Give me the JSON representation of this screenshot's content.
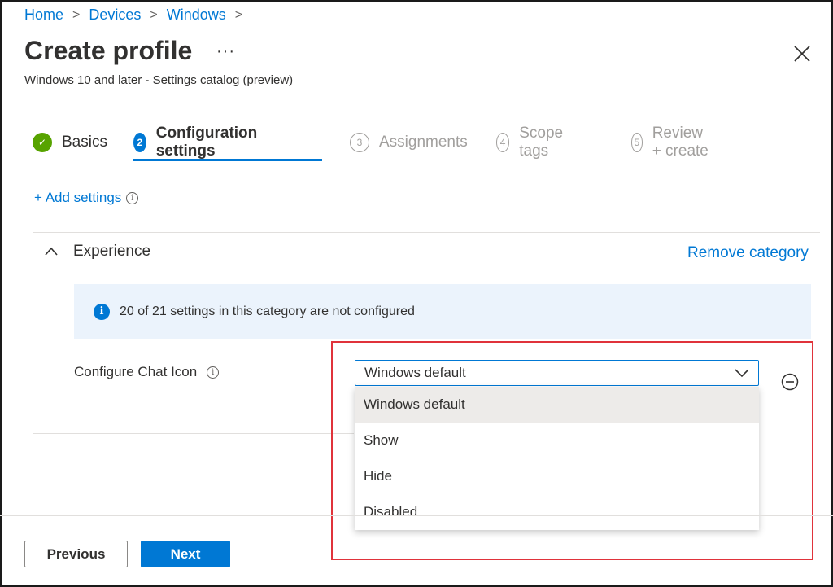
{
  "breadcrumb": [
    "Home",
    "Devices",
    "Windows"
  ],
  "header": {
    "title": "Create profile",
    "more": "···",
    "subtitle": "Windows 10 and later - Settings catalog (preview)"
  },
  "steps": [
    {
      "number": "✓",
      "label": "Basics",
      "state": "done"
    },
    {
      "number": "2",
      "label": "Configuration settings",
      "state": "active"
    },
    {
      "number": "3",
      "label": "Assignments",
      "state": "pending"
    },
    {
      "number": "4",
      "label": "Scope tags",
      "state": "pending"
    },
    {
      "number": "5",
      "label": "Review + create",
      "state": "pending"
    }
  ],
  "add_settings": {
    "label": "+ Add settings",
    "info": "i"
  },
  "category": {
    "name": "Experience",
    "remove_label": "Remove category",
    "info_message": "20 of 21 settings in this category are not configured",
    "info_icon": "i"
  },
  "setting": {
    "label": "Configure Chat Icon",
    "info": "i",
    "selected_value": "Windows default",
    "options": [
      "Windows default",
      "Show",
      "Hide",
      "Disabled"
    ]
  },
  "footer": {
    "previous_label": "Previous",
    "next_label": "Next"
  },
  "colors": {
    "accent": "#0078d4",
    "success": "#57a300",
    "highlight": "#e0333b",
    "info_bg": "#ebf3fc"
  }
}
